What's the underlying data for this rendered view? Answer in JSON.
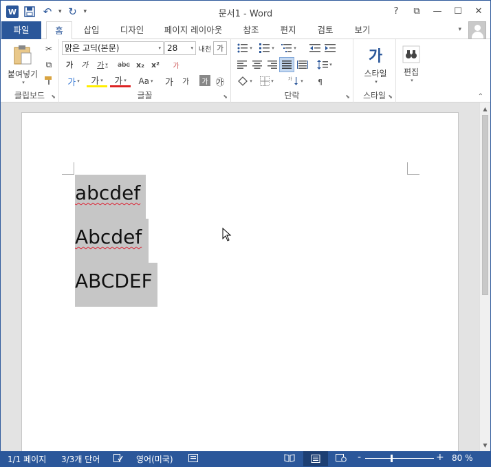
{
  "window": {
    "title": "문서1 - Word",
    "logo_letter": "W",
    "help": "?",
    "controls": {
      "ribbon_display": "⧉",
      "minimize": "—",
      "maximize": "☐",
      "close": "✕"
    }
  },
  "qat": {
    "save_icon": "floppy-icon",
    "undo_glyph": "↶",
    "redo_glyph": "↻",
    "customize_glyph": "▾"
  },
  "tabs": {
    "file": "파일",
    "items": [
      "홈",
      "삽입",
      "디자인",
      "페이지 레이아웃",
      "참조",
      "편지",
      "검토",
      "보기"
    ]
  },
  "ribbon": {
    "clipboard": {
      "label": "클립보드",
      "paste": "붙여넣기",
      "cut_glyph": "✂",
      "copy_glyph": "⧉",
      "format_painter_glyph": "🖌"
    },
    "font": {
      "label": "글꼴",
      "font_name": "맑은 고딕(본문)",
      "font_size": "28",
      "grow": "내천",
      "shrink": "가",
      "bold": "가",
      "italic": "가",
      "underline": "가",
      "strike": "abc",
      "subscript": "x₂",
      "superscript": "x²",
      "clear": "가",
      "effects": "가",
      "highlight": "가",
      "color": "가",
      "case": "Aa",
      "phonetic": "가",
      "char_shade": "가",
      "enclose": "㉮"
    },
    "paragraph": {
      "label": "단락"
    },
    "styles": {
      "label": "스타일",
      "button": "스타일",
      "glyph": "가"
    },
    "editing": {
      "button": "편집"
    }
  },
  "document": {
    "lines": [
      "abcdef",
      "Abcdef",
      "ABCDEF"
    ]
  },
  "statusbar": {
    "page": "1/1 페이지",
    "words": "3/3개 단어",
    "language": "영어(미국)",
    "zoom_minus": "-",
    "zoom_plus": "+",
    "zoom": "80 %"
  },
  "colors": {
    "accent": "#2b579a",
    "selection": "#c6c6c6",
    "spell_error": "#dd2222"
  }
}
